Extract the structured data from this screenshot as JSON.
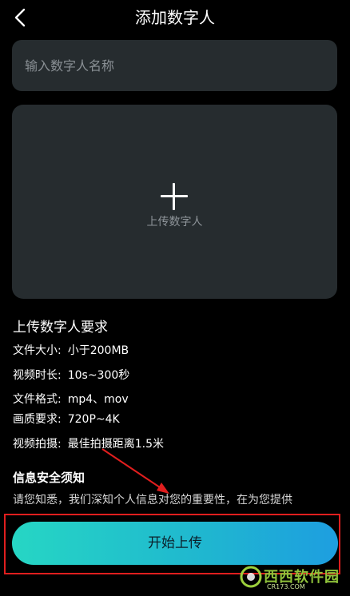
{
  "header": {
    "title": "添加数字人"
  },
  "name_input": {
    "placeholder": "输入数字人名称",
    "value": ""
  },
  "upload": {
    "label": "上传数字人"
  },
  "requirements": {
    "title": "上传数字人要求",
    "items": [
      {
        "label": "文件大小:",
        "value": "小于200MB"
      },
      {
        "label": "视频时长:",
        "value": "10s~300秒"
      },
      {
        "label": "文件格式:",
        "value": "mp4、mov"
      },
      {
        "label": "画质要求:",
        "value": "720P~4K"
      },
      {
        "label": "视频拍摄:",
        "value": "最佳拍摄距离1.5米"
      }
    ]
  },
  "security": {
    "title": "信息安全须知",
    "text": "请您知悉，我们深知个人信息对您的重要性，在为您提供"
  },
  "start_button": {
    "label": "开始上传"
  },
  "watermark": {
    "text": "西西软件园",
    "sub": "CR173.COM"
  },
  "colors": {
    "background": "#000000",
    "card": "#262c2f",
    "button_gradient_start": "#26d6c4",
    "button_gradient_end": "#1e9ee0",
    "annotation": "#e01e1e"
  },
  "icons": {
    "back": "chevron-left-icon",
    "upload": "plus-icon"
  }
}
